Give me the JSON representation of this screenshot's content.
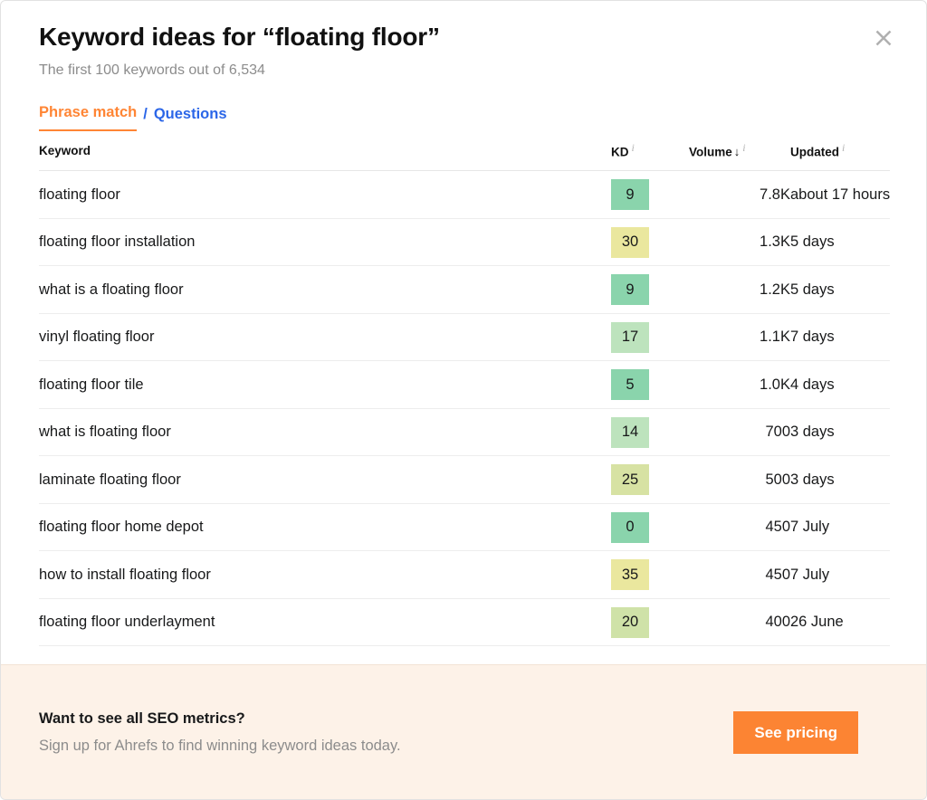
{
  "modal": {
    "title": "Keyword ideas for “floating floor”",
    "subtitle": "The first 100 keywords out of 6,534",
    "close_icon": "close-icon"
  },
  "tabs": {
    "active_label": "Phrase match",
    "separator": "/",
    "other_label": "Questions",
    "active_color": "#ff8534",
    "link_color": "#2b66e8"
  },
  "table": {
    "headers": {
      "keyword": "Keyword",
      "kd": "KD",
      "volume": "Volume",
      "updated": "Updated",
      "sort_arrow": "↓",
      "info_glyph": "i"
    },
    "rows": [
      {
        "keyword": "floating floor",
        "kd": "9",
        "kd_color": "#8ad4ac",
        "volume": "7.8K",
        "updated": "about 17 hours"
      },
      {
        "keyword": "floating floor installation",
        "kd": "30",
        "kd_color": "#eae79e",
        "volume": "1.3K",
        "updated": "5 days"
      },
      {
        "keyword": "what is a floating floor",
        "kd": "9",
        "kd_color": "#8ad4ac",
        "volume": "1.2K",
        "updated": "5 days"
      },
      {
        "keyword": "vinyl floating floor",
        "kd": "17",
        "kd_color": "#bde3bd",
        "volume": "1.1K",
        "updated": "7 days"
      },
      {
        "keyword": "floating floor tile",
        "kd": "5",
        "kd_color": "#8ad4ac",
        "volume": "1.0K",
        "updated": "4 days"
      },
      {
        "keyword": "what is floating floor",
        "kd": "14",
        "kd_color": "#bde3bd",
        "volume": "700",
        "updated": "3 days"
      },
      {
        "keyword": "laminate floating floor",
        "kd": "25",
        "kd_color": "#d7e2a3",
        "volume": "500",
        "updated": "3 days"
      },
      {
        "keyword": "floating floor home depot",
        "kd": "0",
        "kd_color": "#8ad4ac",
        "volume": "450",
        "updated": "7 July"
      },
      {
        "keyword": "how to install floating floor",
        "kd": "35",
        "kd_color": "#eae79e",
        "volume": "450",
        "updated": "7 July"
      },
      {
        "keyword": "floating floor underlayment",
        "kd": "20",
        "kd_color": "#cfe2a8",
        "volume": "400",
        "updated": "26 June"
      }
    ]
  },
  "cta": {
    "title": "Want to see all SEO metrics?",
    "subtitle": "Sign up for Ahrefs to find winning keyword ideas today.",
    "button_label": "See pricing",
    "background": "#fdf2e8",
    "button_color": "#fc8433"
  }
}
